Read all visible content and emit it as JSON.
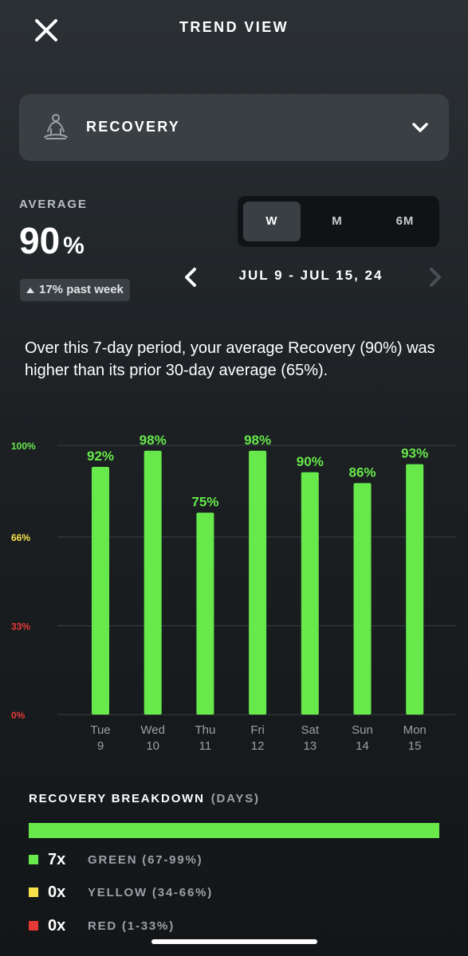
{
  "header": {
    "title": "TREND VIEW",
    "close_icon": "close-icon"
  },
  "metric_select": {
    "label": "RECOVERY",
    "icon": "meditation-icon",
    "chevron_icon": "chevron-down-icon"
  },
  "average": {
    "label": "AVERAGE",
    "value": "90",
    "unit": "%",
    "change": "17% past week",
    "change_direction": "up"
  },
  "range_tabs": [
    {
      "label": "W",
      "active": true
    },
    {
      "label": "M",
      "active": false
    },
    {
      "label": "6M",
      "active": false
    }
  ],
  "date_nav": {
    "range": "JUL 9 - JUL 15, 24",
    "prev_icon": "chevron-left-icon",
    "next_icon": "chevron-right-icon"
  },
  "summary": "Over this 7-day period, your average Recovery (90%) was higher than its prior 30-day average (65%).",
  "colors": {
    "green": "#67e94b",
    "yellow": "#f5e24a",
    "red": "#e53935",
    "bar": "#67e94b"
  },
  "chart_data": {
    "type": "bar",
    "categories": [
      "Tue 9",
      "Wed 10",
      "Thu 11",
      "Fri 12",
      "Sat 13",
      "Sun 14",
      "Mon 15"
    ],
    "day_names": [
      "Tue",
      "Wed",
      "Thu",
      "Fri",
      "Sat",
      "Sun",
      "Mon"
    ],
    "day_numbers": [
      "9",
      "10",
      "11",
      "12",
      "13",
      "14",
      "15"
    ],
    "values": [
      92,
      98,
      75,
      98,
      90,
      86,
      93
    ],
    "value_labels": [
      "92%",
      "98%",
      "75%",
      "98%",
      "90%",
      "86%",
      "93%"
    ],
    "y_ticks": [
      {
        "value": 100,
        "label": "100%",
        "color": "#67e94b"
      },
      {
        "value": 66,
        "label": "66%",
        "color": "#f5e24a"
      },
      {
        "value": 33,
        "label": "33%",
        "color": "#e53935"
      },
      {
        "value": 0,
        "label": "0%",
        "color": "#e53935"
      }
    ],
    "ylim": [
      0,
      100
    ],
    "grid": true
  },
  "breakdown": {
    "title": "RECOVERY BREAKDOWN",
    "subtitle": "(DAYS)",
    "rows": [
      {
        "count": "7x",
        "label": "GREEN (67-99%)",
        "color": "#67e94b"
      },
      {
        "count": "0x",
        "label": "YELLOW (34-66%)",
        "color": "#f5e24a"
      },
      {
        "count": "0x",
        "label": "RED (1-33%)",
        "color": "#e53935"
      }
    ]
  }
}
